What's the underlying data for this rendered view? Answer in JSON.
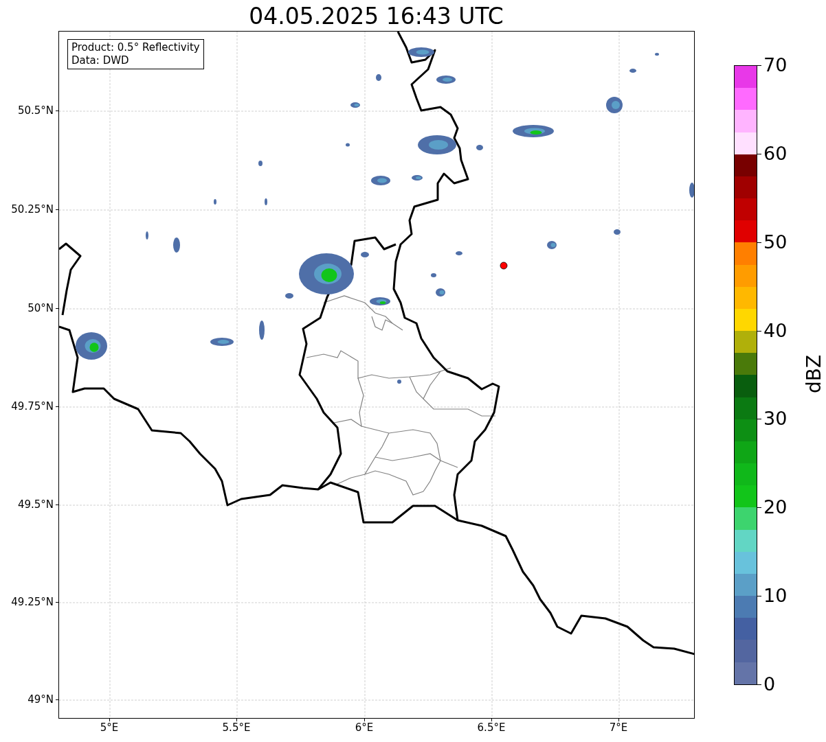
{
  "title": "04.05.2025 16:43 UTC",
  "info_box": {
    "lines": [
      "Product: 0.5° Reflectivity",
      "Data: DWD"
    ]
  },
  "map": {
    "lat_ticks": [
      "50.5°N",
      "50.25°N",
      "50°N",
      "49.75°N",
      "49.5°N",
      "49.25°N",
      "49°N"
    ],
    "lon_ticks": [
      "5°E",
      "5.5°E",
      "6°E",
      "6.5°E",
      "7°E"
    ]
  },
  "colorbar": {
    "label": "dBZ",
    "ticks": [
      "70",
      "60",
      "50",
      "40",
      "30",
      "20",
      "10",
      "0"
    ],
    "segments": [
      {
        "color": "#e838e8"
      },
      {
        "color": "#ff6aff"
      },
      {
        "color": "#ffb4ff"
      },
      {
        "color": "#ffe0ff"
      },
      {
        "color": "#780000"
      },
      {
        "color": "#a00000"
      },
      {
        "color": "#c00000"
      },
      {
        "color": "#e00000"
      },
      {
        "color": "#ff7f00"
      },
      {
        "color": "#ff9c00"
      },
      {
        "color": "#ffb800"
      },
      {
        "color": "#ffd700"
      },
      {
        "color": "#b0b00a"
      },
      {
        "color": "#4a7a0a"
      },
      {
        "color": "#095e0e"
      },
      {
        "color": "#0b7a12"
      },
      {
        "color": "#0d8f14"
      },
      {
        "color": "#0fa616"
      },
      {
        "color": "#10b81a"
      },
      {
        "color": "#12c51a"
      },
      {
        "color": "#3dd46e"
      },
      {
        "color": "#62d6c4"
      },
      {
        "color": "#68c2dc"
      },
      {
        "color": "#5b9fc7"
      },
      {
        "color": "#4c7bb2"
      },
      {
        "color": "#4460a2"
      },
      {
        "color": "#5366a0"
      },
      {
        "color": "#6474a8"
      }
    ]
  }
}
